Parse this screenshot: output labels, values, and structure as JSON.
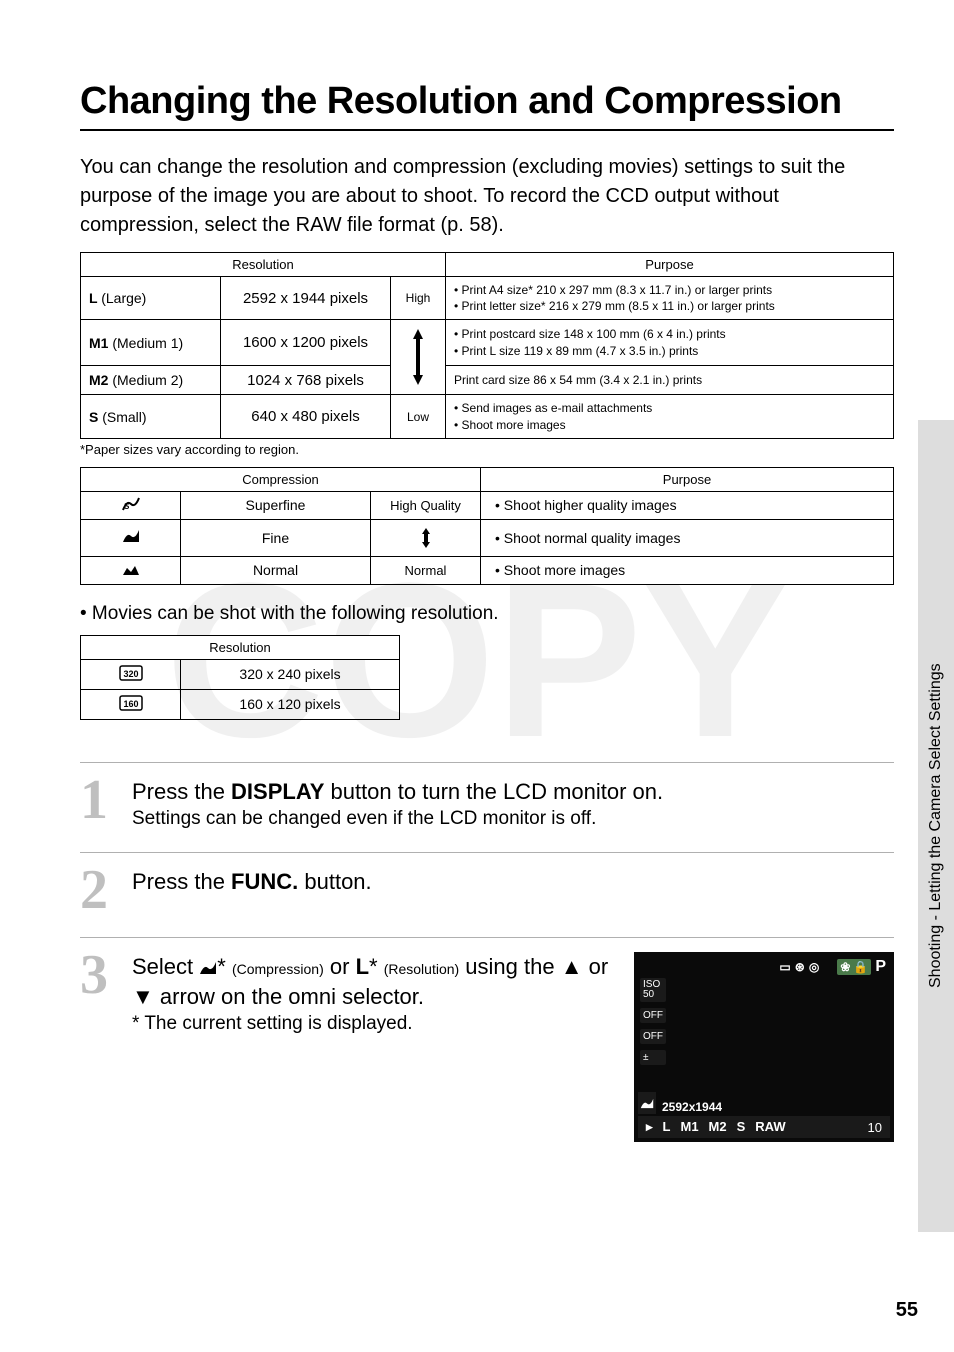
{
  "title": "Changing the Resolution and Compression",
  "intro": "You can change the resolution and compression (excluding movies) settings to suit the purpose of the image you are about to shoot. To record the CCD output without compression, select the RAW file format (p. 58).",
  "resTable": {
    "headers": {
      "resolution": "Resolution",
      "purpose": "Purpose"
    },
    "levels": {
      "high": "High",
      "low": "Low"
    },
    "rows": [
      {
        "code": "L",
        "label": "(Large)",
        "pixels": "2592  x 1944 pixels",
        "purpose": "• Print A4 size* 210 x 297 mm (8.3 x 11.7 in.) or larger prints\n• Print letter size* 216 x 279 mm (8.5 x 11 in.) or larger prints"
      },
      {
        "code": "M1",
        "label": "(Medium 1)",
        "pixels": "1600  x 1200 pixels",
        "purpose": "• Print postcard size 148 x 100 mm (6 x 4 in.) prints\n• Print L size 119 x 89 mm (4.7 x 3.5 in.) prints"
      },
      {
        "code": "M2",
        "label": "(Medium 2)",
        "pixels": "1024 x  768 pixels",
        "purpose": "Print card size 86 x 54 mm (3.4 x 2.1 in.) prints"
      },
      {
        "code": "S",
        "label": "(Small)",
        "pixels": "640 x  480 pixels",
        "purpose": "• Send images as e-mail attachments\n• Shoot more images"
      }
    ]
  },
  "footnote": "*Paper sizes vary according to region.",
  "compTable": {
    "headers": {
      "compression": "Compression",
      "purpose": "Purpose"
    },
    "levels": {
      "high": "High Quality",
      "low": "Normal"
    },
    "rows": [
      {
        "icon": "superfine",
        "name": "Superfine",
        "purpose": "• Shoot higher quality images"
      },
      {
        "icon": "fine",
        "name": "Fine",
        "purpose": "• Shoot normal quality images"
      },
      {
        "icon": "normal",
        "name": "Normal",
        "purpose": "• Shoot more images"
      }
    ]
  },
  "movieNote": "• Movies can be shot with the following resolution.",
  "movieTable": {
    "header": "Resolution",
    "rows": [
      {
        "icon": "320",
        "pixels": "320 x 240 pixels"
      },
      {
        "icon": "160",
        "pixels": "160 x 120 pixels"
      }
    ]
  },
  "steps": {
    "s1": {
      "num": "1",
      "pre": "Press the ",
      "bold": "DISPLAY",
      "post": " button to turn the LCD monitor on.",
      "sub": "Settings can be changed even if the LCD monitor is off."
    },
    "s2": {
      "num": "2",
      "pre": "Press the ",
      "bold": "FUNC.",
      "post": " button."
    },
    "s3": {
      "num": "3",
      "pre": "Select ",
      "star1": "*",
      "compLabel": "(Compression)",
      "or": " or ",
      "resSym": "L",
      "star2": "*",
      "resLabel": "(Resolution)",
      "using": " using the ▲ or ▼ arrow on the omni selector.",
      "sub": "* The current setting is displayed."
    }
  },
  "lcd": {
    "topRight": {
      "card": "▭",
      "flash": "⊛",
      "target": "◎",
      "macro": "❀",
      "lock": "🔒",
      "mode": "P"
    },
    "leftCol": [
      "ISO\n50",
      "OFF",
      "OFF",
      "±"
    ],
    "sizeText": "2592x1944",
    "bottomLeftIcon": "◢",
    "bottomLeftL": "L",
    "bottom": {
      "arrow": "▸",
      "opts": [
        "L",
        "M1",
        "M2",
        "S",
        "RAW"
      ],
      "count": "10"
    }
  },
  "sideTab": "Shooting - Letting the Camera Select Settings",
  "pageNum": "55",
  "watermark": "COPY"
}
